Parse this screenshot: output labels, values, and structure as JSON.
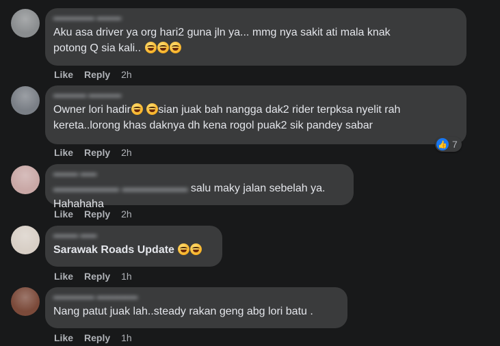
{
  "comments": [
    {
      "text": "Aku asa driver ya org hari2 guna jln ya... mmg nya sakit ati mala knak\npotong Q sia kali.. ",
      "like_label": "Like",
      "reply_label": "Reply",
      "time": "2h",
      "emojis": [
        "rofl-emoji",
        "rofl-emoji",
        "rofl-emoji"
      ]
    },
    {
      "text": "Owner lori hadir",
      "text_after": "sian juak bah nangga dak2 rider terpksa nyelit rah\nkereta..lorong khas daknya dh kena rogol puak2 sik pandey sabar",
      "like_label": "Like",
      "reply_label": "Reply",
      "time": "2h",
      "reaction_count": "7"
    },
    {
      "text": "salu maky jalan sebelah ya. Hahahaha",
      "like_label": "Like",
      "reply_label": "Reply",
      "time": "2h"
    },
    {
      "text": "Sarawak Roads Update ",
      "like_label": "Like",
      "reply_label": "Reply",
      "time": "1h"
    },
    {
      "text": "Nang patut juak lah..steady rakan geng abg lori batu .",
      "like_label": "Like",
      "reply_label": "Reply",
      "time": "1h"
    }
  ]
}
